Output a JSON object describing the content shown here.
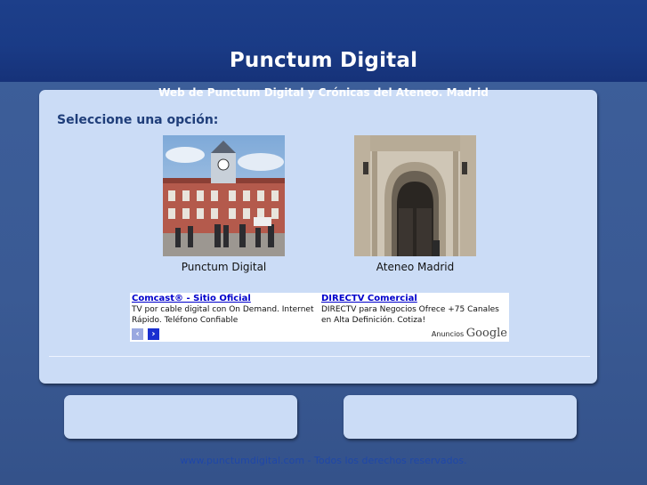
{
  "site": {
    "title": "Punctum Digital",
    "subtitle": "Web de Punctum Digital y Crónicas del Ateneo. Madrid"
  },
  "main": {
    "prompt": "Seleccione una opción:",
    "options": [
      {
        "label": "Punctum Digital",
        "image": "town-hall-photo"
      },
      {
        "label": "Ateneo Madrid",
        "image": "ateneo-doorway-photo"
      }
    ]
  },
  "ads": {
    "items": [
      {
        "title": "Comcast® - Sitio Oficial",
        "desc": "TV por cable digital con On Demand. Internet Rápido. Teléfono Confiable"
      },
      {
        "title": "DIRECTV Comercial",
        "desc": "DIRECTV para Negocios Ofrece +75 Canales en Alta Definición. Cotiza!"
      }
    ],
    "credit_label": "Anuncios",
    "credit_brand": "Google",
    "prev_icon": "‹",
    "next_icon": "›"
  },
  "footer": {
    "text": "www.punctumdigital.com - Todos los derechos reservados."
  },
  "colors": {
    "header": "#1a3b86",
    "background": "#3a5a94",
    "panel": "#cbdcf6",
    "prompt": "#1f3e7a",
    "ad_link": "#0000cc",
    "footer_text": "#1f47a8"
  }
}
